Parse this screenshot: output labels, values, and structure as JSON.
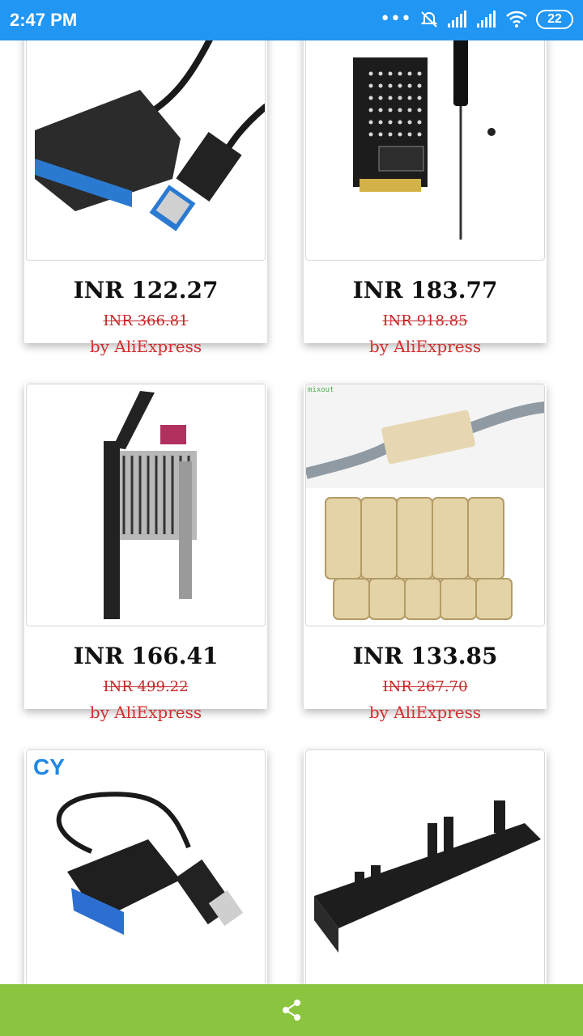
{
  "status_bar": {
    "time": "2:47 PM",
    "battery": "22",
    "icons": [
      "more-dots-icon",
      "alarm-off-icon",
      "signal-icon",
      "signal-icon",
      "wifi-icon",
      "battery-icon"
    ]
  },
  "products": [
    {
      "price": "INR 122.27",
      "original_price": "INR 366.81",
      "seller": "by AliExpress",
      "image": "sata-usb-adapter-cable"
    },
    {
      "price": "INR 183.77",
      "original_price": "INR 918.85",
      "seller": "by AliExpress",
      "image": "m2-adapter-board-with-screwdriver"
    },
    {
      "price": "INR 166.41",
      "original_price": "INR 499.22",
      "seller": "by AliExpress",
      "image": "hdd-tray-caddy"
    },
    {
      "price": "INR 133.85",
      "original_price": "INR 267.70",
      "seller": "by AliExpress",
      "image": "rj45-coupler-pack",
      "image_tag": "mixout"
    },
    {
      "image": "sata-usb3-cable",
      "logo_text": "CY"
    },
    {
      "image": "drive-rail-bracket"
    }
  ],
  "bottom_bar": {
    "icon": "share-icon"
  }
}
